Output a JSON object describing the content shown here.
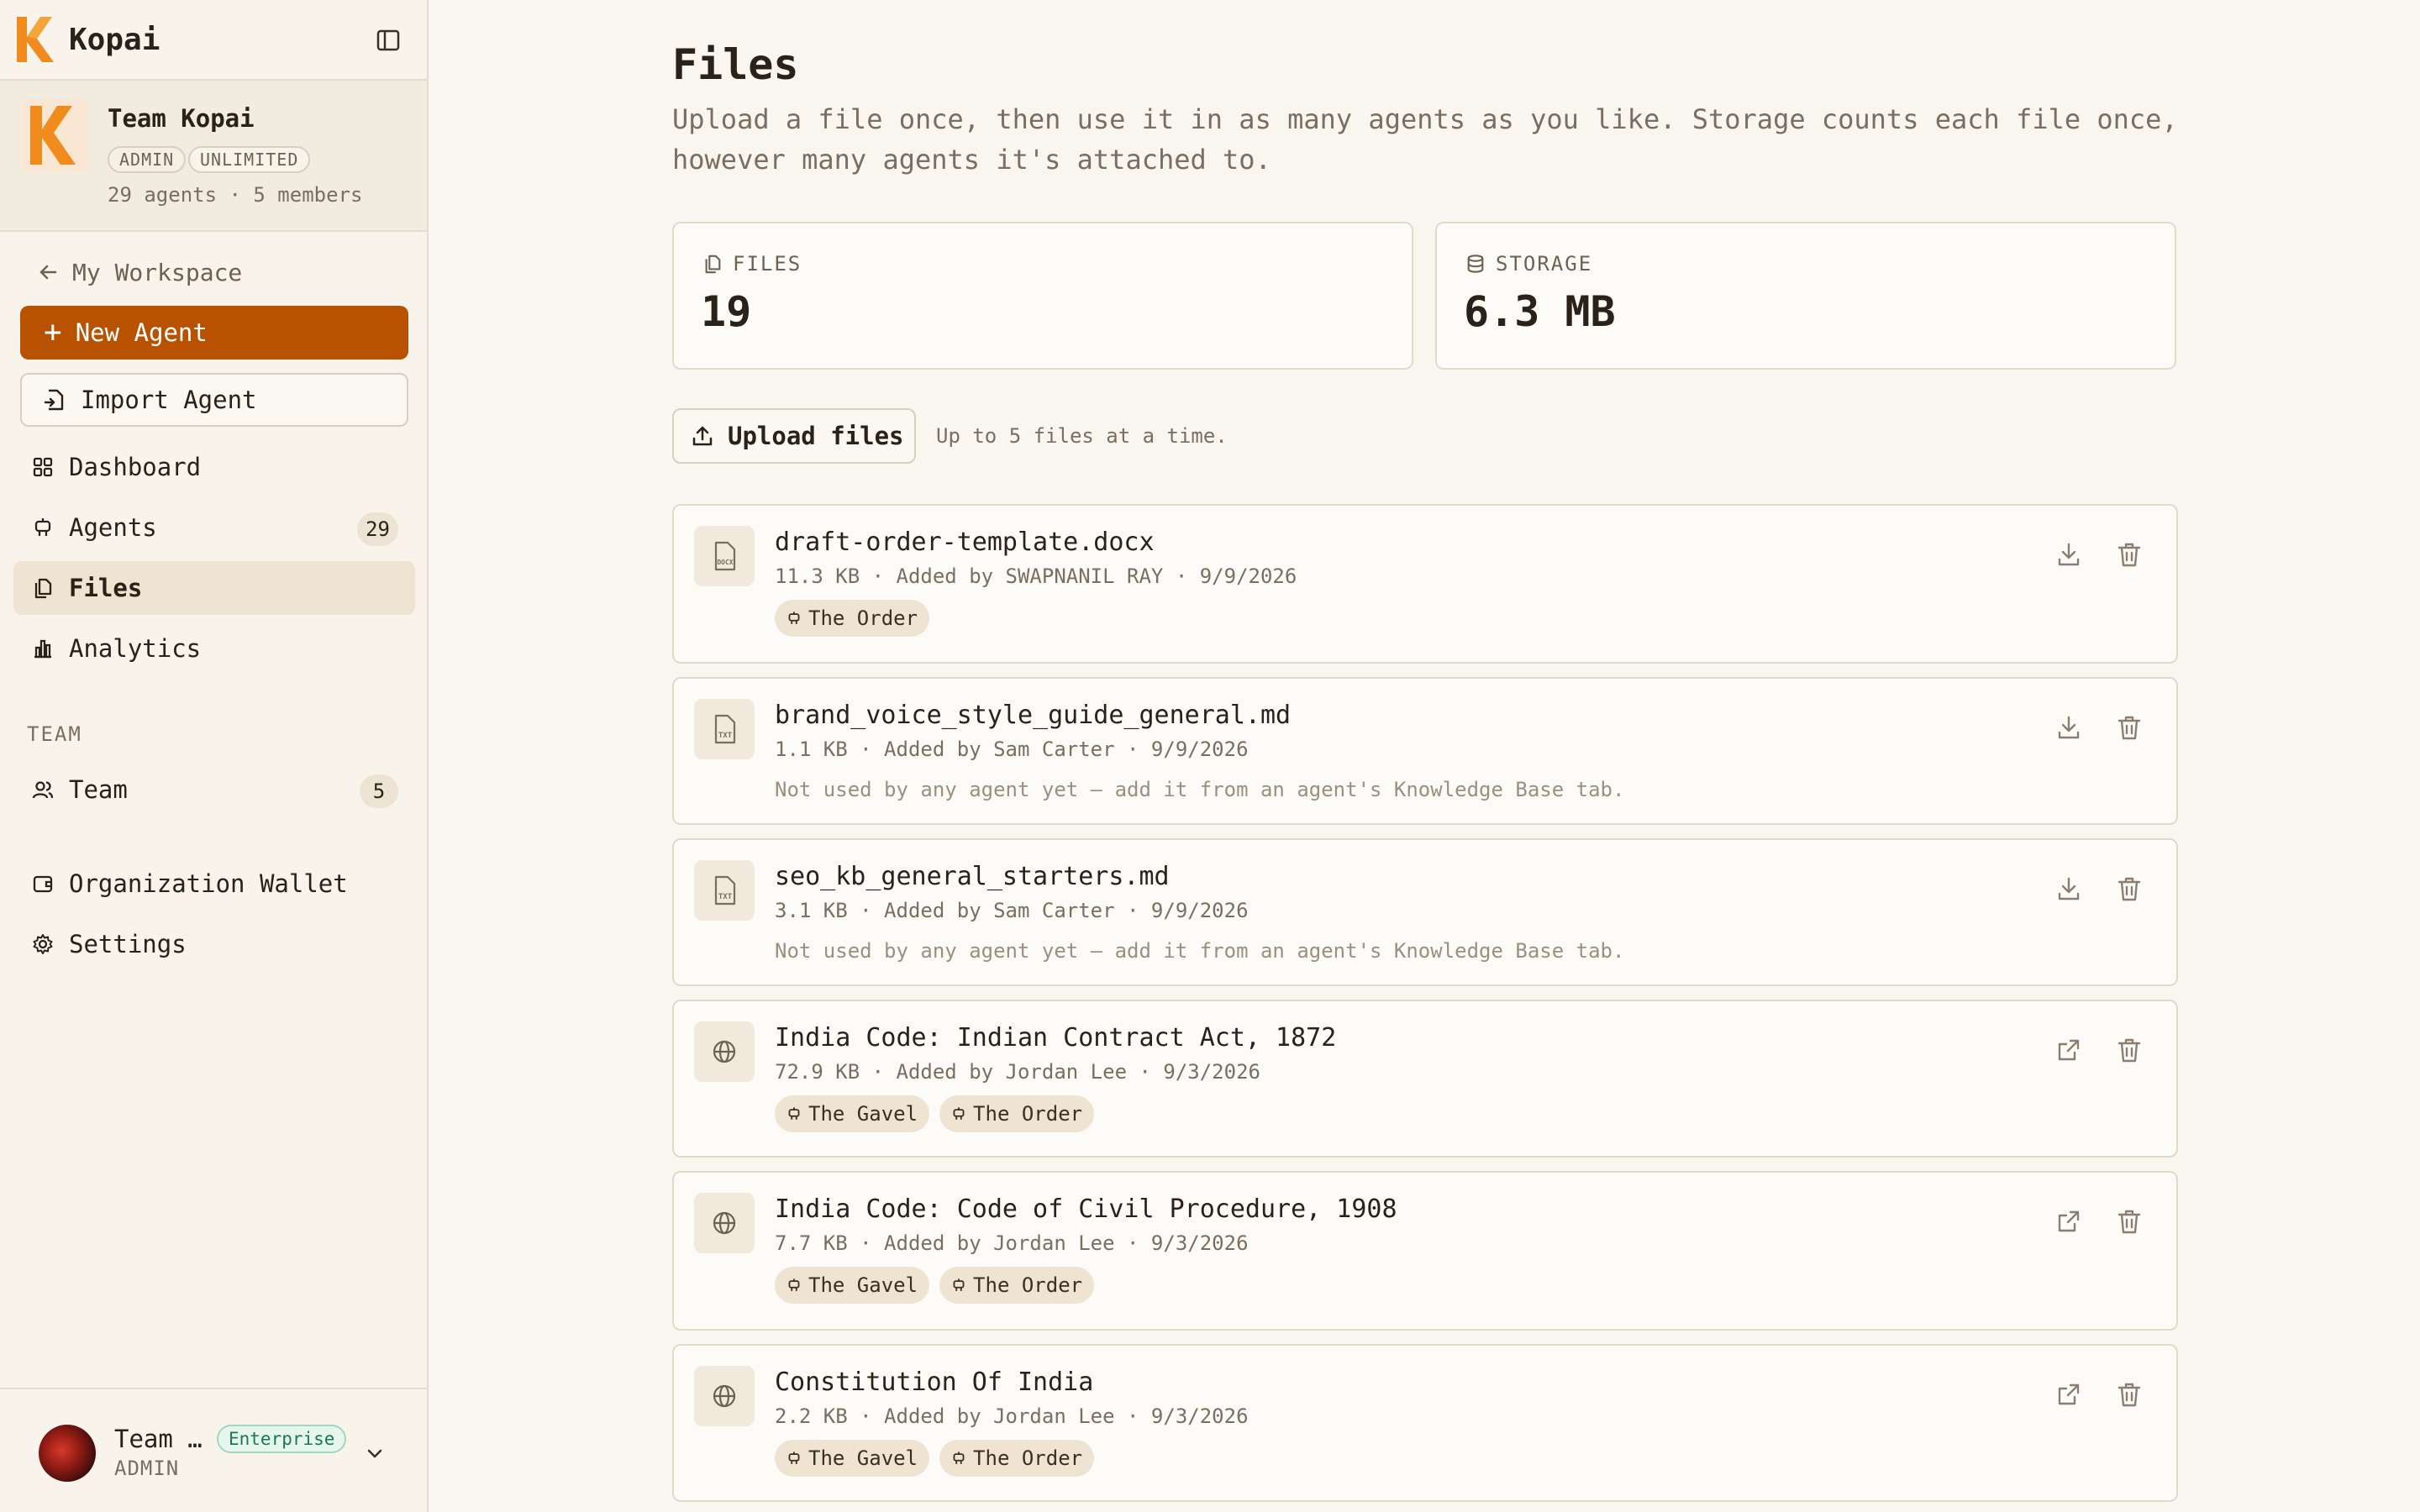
{
  "brand": {
    "name": "Kopai"
  },
  "team": {
    "name": "Team Kopai",
    "role_badge": "ADMIN",
    "plan_badge": "UNLIMITED",
    "meta": "29 agents · 5 members"
  },
  "nav": {
    "back": "My Workspace",
    "new_agent": "New Agent",
    "import_agent": "Import Agent",
    "items": [
      {
        "label": "Dashboard",
        "icon": "dashboard-icon"
      },
      {
        "label": "Agents",
        "icon": "bot-icon",
        "count": "29"
      },
      {
        "label": "Files",
        "icon": "files-icon",
        "active": true
      },
      {
        "label": "Analytics",
        "icon": "chart-icon"
      }
    ],
    "section_team": "TEAM",
    "team_item": {
      "label": "Team",
      "count": "5"
    },
    "wallet": "Organization Wallet",
    "settings": "Settings"
  },
  "user": {
    "name": "Team …",
    "role": "ADMIN",
    "plan": "Enterprise"
  },
  "page": {
    "title": "Files",
    "description": "Upload a file once, then use it in as many agents as you like. Storage counts each file once, however many agents it's attached to."
  },
  "stats": {
    "files_label": "FILES",
    "files_value": "19",
    "storage_label": "STORAGE",
    "storage_value": "6.3 MB"
  },
  "upload": {
    "button": "Upload files",
    "hint": "Up to 5 files at a time."
  },
  "files": [
    {
      "name": "draft-order-template.docx",
      "meta": "11.3 KB · Added by SWAPNANIL RAY · 9/9/2026",
      "icon": "docx-file-icon",
      "tags": [
        "The Order"
      ]
    },
    {
      "name": "brand_voice_style_guide_general.md",
      "meta": "1.1 KB · Added by Sam Carter · 9/9/2026",
      "icon": "txt-file-icon",
      "note": "Not used by any agent yet — add it from an agent's Knowledge Base tab."
    },
    {
      "name": "seo_kb_general_starters.md",
      "meta": "3.1 KB · Added by Sam Carter · 9/9/2026",
      "icon": "txt-file-icon",
      "note": "Not used by any agent yet — add it from an agent's Knowledge Base tab."
    },
    {
      "name": "India Code: Indian Contract Act, 1872",
      "meta": "72.9 KB · Added by Jordan Lee · 9/3/2026",
      "icon": "globe-icon",
      "tags": [
        "The Gavel",
        "The Order"
      ]
    },
    {
      "name": "India Code: Code of Civil Procedure, 1908",
      "meta": "7.7 KB · Added by Jordan Lee · 9/3/2026",
      "icon": "globe-icon",
      "tags": [
        "The Gavel",
        "The Order"
      ]
    },
    {
      "name": "Constitution Of India",
      "meta": "2.2 KB · Added by Jordan Lee · 9/3/2026",
      "icon": "globe-icon",
      "tags": [
        "The Gavel",
        "The Order"
      ]
    }
  ],
  "colors": {
    "accent": "#b95200",
    "background": "#f9f6ef",
    "sidebar": "#f8f4ec",
    "enterprise_green": "#177a52"
  }
}
